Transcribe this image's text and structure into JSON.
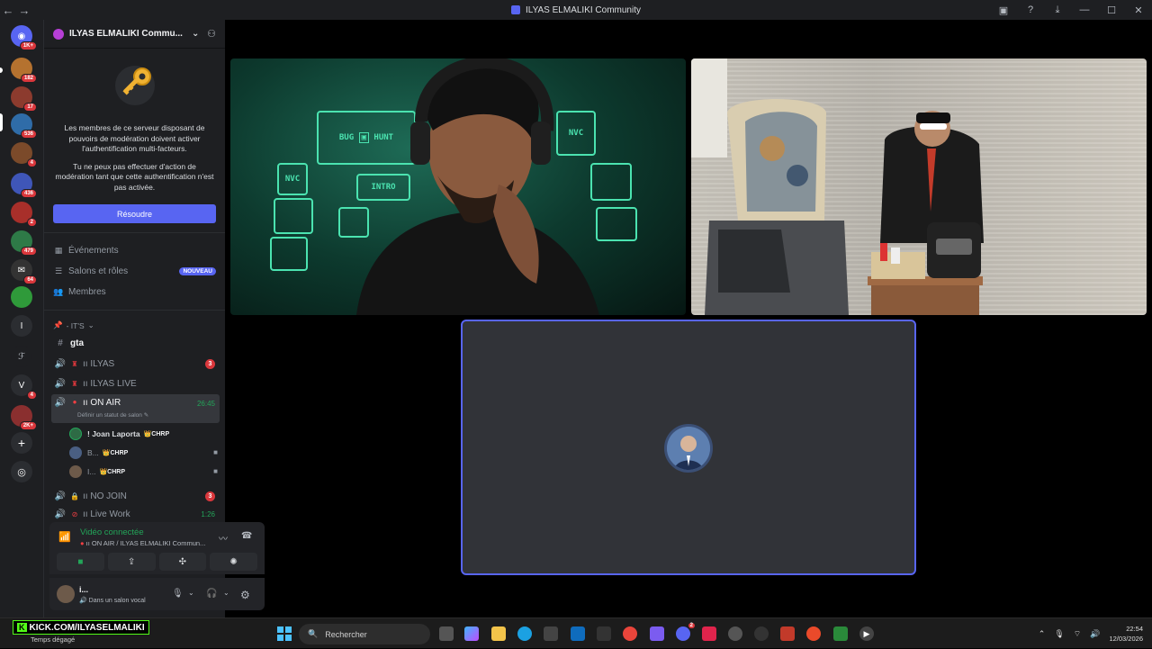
{
  "window": {
    "title": "ILYAS ELMALIKI Community",
    "back": "←",
    "forward": "→"
  },
  "rail": {
    "badges": [
      "1K+",
      "182",
      "17",
      "536",
      "4",
      "436",
      "2",
      "479",
      "64",
      "4",
      "2K+"
    ],
    "letter_servers": [
      "I",
      "V"
    ]
  },
  "server": {
    "name": "ILYAS ELMALIKI Commu...",
    "mfa_text_1": "Les membres de ce serveur disposant de pouvoirs de modération doivent activer l'authentification multi-facteurs.",
    "mfa_text_2": "Tu ne peux pas effectuer d'action de modération tant que cette authentification n'est pas activée.",
    "resolve_label": "Résoudre"
  },
  "nav": {
    "events": "Événements",
    "channels_roles": "Salons et rôles",
    "new_badge": "NOUVEAU",
    "members": "Membres"
  },
  "category": {
    "name": "- IT'S"
  },
  "channels": [
    {
      "name": "gta",
      "type": "text"
    },
    {
      "name": "ILYAS",
      "prefix": "ıı",
      "count": "3"
    },
    {
      "name": "ILYAS LIVE",
      "prefix": "ıı"
    },
    {
      "name": "ON AIR",
      "prefix": "ıı",
      "time": "26:45",
      "status": "Définir un statut de salon"
    },
    {
      "name": "NO JOIN",
      "prefix": "ıı",
      "count": "3"
    },
    {
      "name": "Live Work",
      "prefix": "ıı",
      "time": "1:26"
    }
  ],
  "voice_members": [
    {
      "name": "! Joan Laporta",
      "tag": "CHRP"
    },
    {
      "name": "B...",
      "tag": "CHRP"
    },
    {
      "name": "I...",
      "tag": "CHRP"
    }
  ],
  "voice": {
    "status": "Vidéo connectée",
    "where": "ıı ON AIR / ILYAS ELMALIKI Commun..."
  },
  "user": {
    "name": "i...",
    "status": "Dans un salon vocal"
  },
  "video": {
    "tile1_signs": [
      "BUG",
      "HUNT",
      "NVC",
      "INTRO",
      "NVC"
    ]
  },
  "taskbar": {
    "kick": "KICK.COM/ILYASELMALIKI",
    "kick_k": "K",
    "weather": "Temps dégagé",
    "search": "Rechercher",
    "time": "22:54",
    "date": "12/03/2026",
    "app_badge_discord": "2"
  },
  "colors": {
    "blurple": "#5865f2",
    "green": "#23a559",
    "red": "#da373c",
    "neon": "#4be3b0"
  }
}
